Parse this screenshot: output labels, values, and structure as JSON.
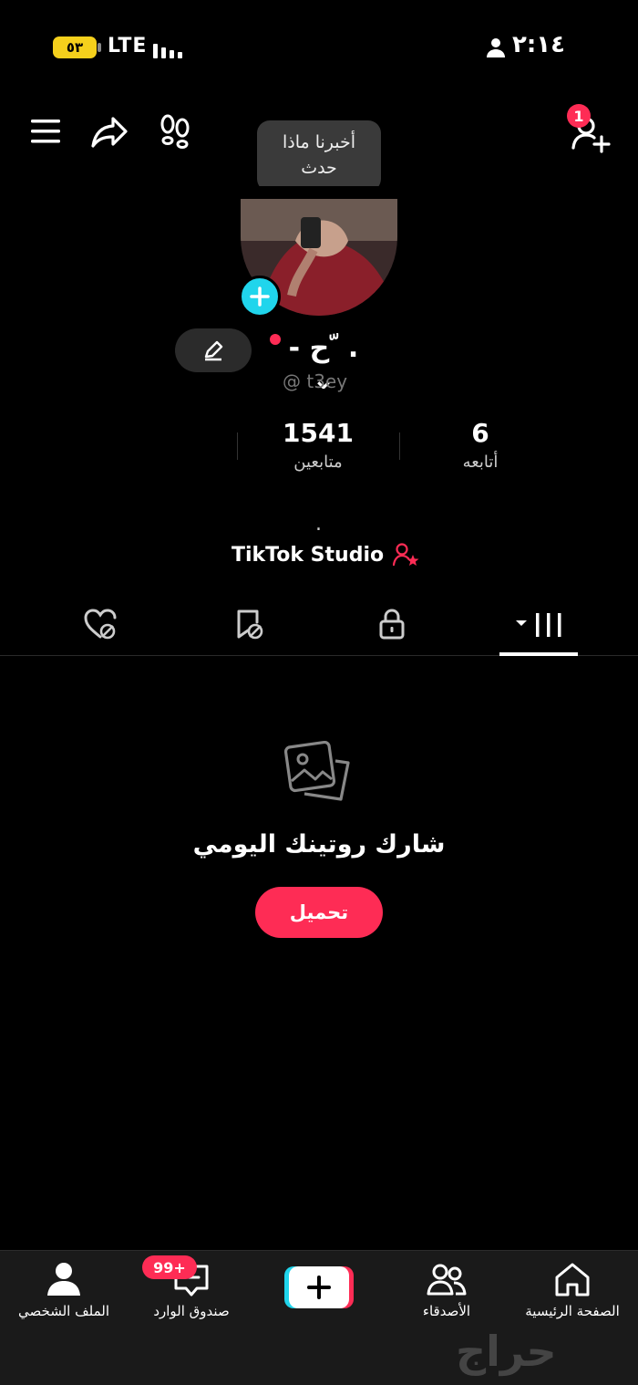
{
  "status_bar": {
    "battery": "٥٣",
    "network": "LTE",
    "time": "٢:١٤"
  },
  "header": {
    "notification_count": "1"
  },
  "tooltip": {
    "line1": "أخبرنا ماذا",
    "line2": "حدث"
  },
  "profile": {
    "name": "- ح ّ . ⌄",
    "handle": "@ t3ey",
    "following_count": "6",
    "following_label": "أتابعه",
    "followers_count": "1541",
    "followers_label": "متابعين",
    "bio": ".",
    "studio_label": "TikTok Studio"
  },
  "tabs": [
    {
      "icon": "grid-icon"
    },
    {
      "icon": "lock-icon"
    },
    {
      "icon": "bookmark-hidden-icon"
    },
    {
      "icon": "liked-hidden-icon"
    }
  ],
  "empty_state": {
    "title": "شارك روتينك اليومي",
    "button": "تحميل"
  },
  "bottom_nav": {
    "home": "الصفحة الرئيسية",
    "friends": "الأصدقاء",
    "inbox": "صندوق الوارد",
    "inbox_badge": "99+",
    "profile": "الملف الشخصي"
  },
  "watermark": "حراج",
  "colors": {
    "accent": "#fe2c55",
    "cyan": "#20d5ec",
    "background": "#000000"
  }
}
